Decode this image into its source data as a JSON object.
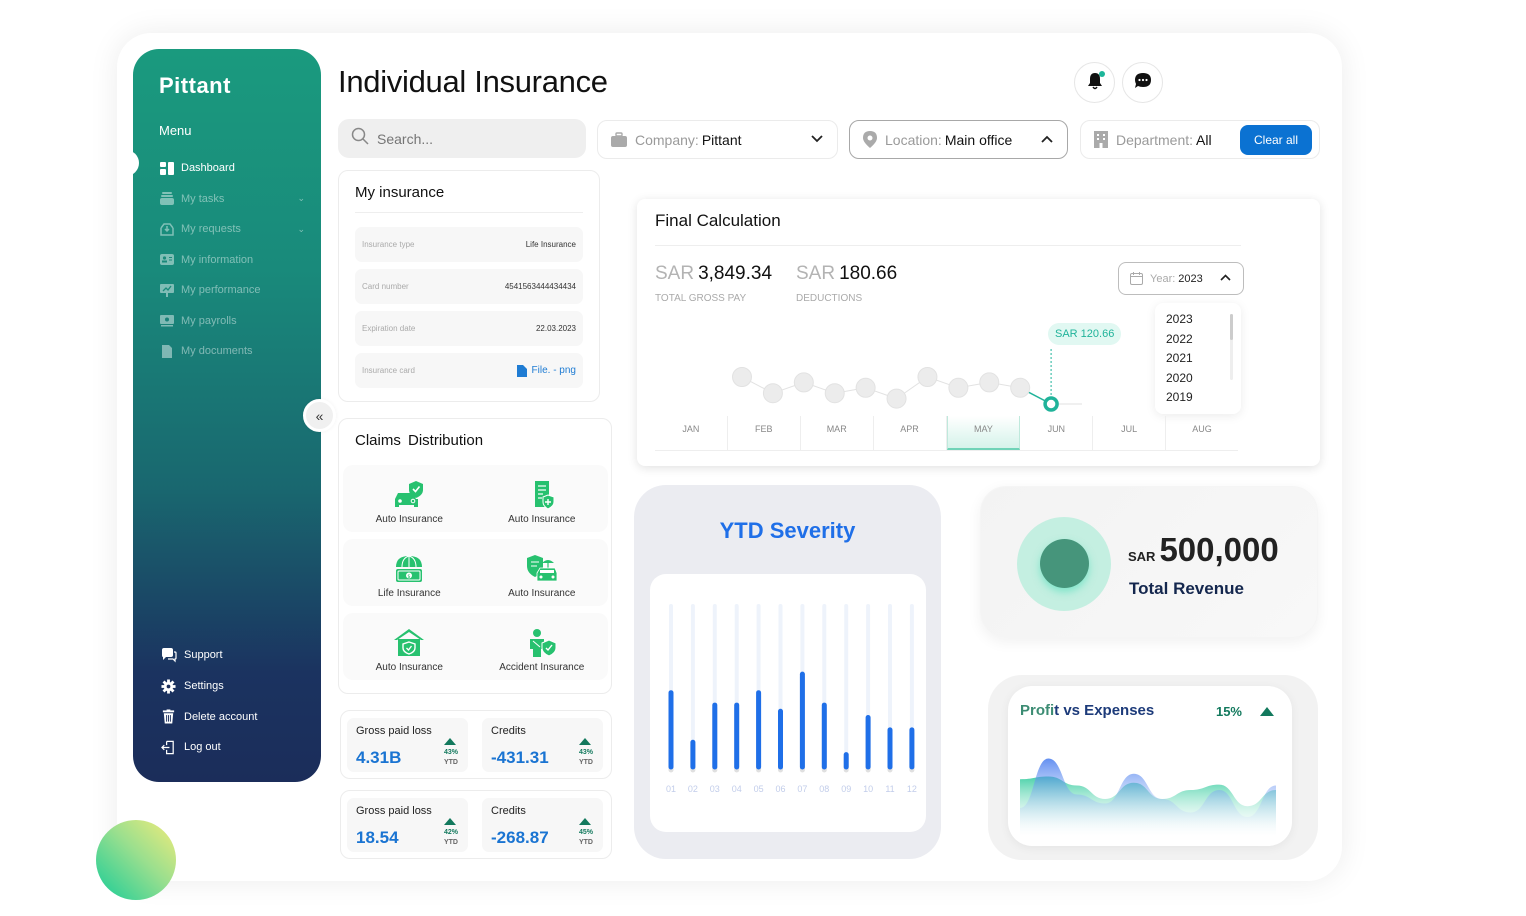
{
  "app": {
    "brand": "Pittant",
    "page_title": "Individual Insurance"
  },
  "sidebar": {
    "menu_title": "Menu",
    "items": [
      {
        "label": "Dashboard",
        "icon": "dashboard-icon",
        "active": true
      },
      {
        "label": "My tasks",
        "icon": "tasks-icon",
        "has_submenu": true
      },
      {
        "label": "My requests",
        "icon": "inbox-icon",
        "has_submenu": true
      },
      {
        "label": "My information",
        "icon": "id-card-icon"
      },
      {
        "label": "My performance",
        "icon": "performance-icon"
      },
      {
        "label": "My payrolls",
        "icon": "payroll-icon"
      },
      {
        "label": "My documents",
        "icon": "document-icon"
      }
    ],
    "bottom_items": [
      {
        "label": "Support",
        "icon": "chat-bubbles-icon"
      },
      {
        "label": "Settings",
        "icon": "gear-icon"
      },
      {
        "label": "Delete account",
        "icon": "trash-icon"
      },
      {
        "label": "Log out",
        "icon": "logout-icon"
      }
    ],
    "collapse_glyph": "«"
  },
  "header": {
    "search_placeholder": "Search...",
    "filters": {
      "company": {
        "label": "Company:",
        "value": "Pittant",
        "arrow": "⌄"
      },
      "location": {
        "label": "Location:",
        "value": "Main office",
        "arrow": "⌃"
      },
      "department": {
        "label": "Department:",
        "value": "All"
      }
    },
    "clear_all": "Clear all"
  },
  "my_insurance": {
    "title": "My insurance",
    "rows": [
      {
        "label": "Insurance type",
        "value": "Life Insurance"
      },
      {
        "label": "Card number",
        "value": "4541563444434434"
      },
      {
        "label": "Expiration date",
        "value": "22.03.2023"
      },
      {
        "label": "Insurance card",
        "value": "File. - png"
      }
    ]
  },
  "claims": {
    "title": "Claims  Distribution",
    "items": [
      {
        "label": "Auto Insurance",
        "icon": "car-shield-icon"
      },
      {
        "label": "Auto Insurance",
        "icon": "document-shield-icon"
      },
      {
        "label": "Life Insurance",
        "icon": "umbrella-money-icon"
      },
      {
        "label": "Auto Insurance",
        "icon": "car-umbrella-icon"
      },
      {
        "label": "Auto Insurance",
        "icon": "house-shield-icon"
      },
      {
        "label": "Accident Insurance",
        "icon": "person-shield-icon"
      }
    ]
  },
  "stats": [
    [
      {
        "title": "Gross paid loss",
        "value": "4.31B",
        "pct": "43%",
        "period": "YTD"
      },
      {
        "title": "Credits",
        "value": "-431.31",
        "pct": "43%",
        "period": "YTD"
      }
    ],
    [
      {
        "title": "Gross paid loss",
        "value": "18.54",
        "pct": "42%",
        "period": "YTD"
      },
      {
        "title": "Credits",
        "value": "-268.87",
        "pct": "45%",
        "period": "YTD"
      }
    ]
  ],
  "final_calc": {
    "title": "Final Calculation",
    "currency": "SAR",
    "gross_pay": "3,849.34",
    "gross_pay_caption": "TOTAL GROSS PAY",
    "deductions": "180.66",
    "deductions_caption": "DEDUCTIONS",
    "year_label": "Year:",
    "year_value": "2023",
    "year_options": [
      "2023",
      "2022",
      "2021",
      "2020",
      "2019"
    ],
    "tooltip": "SAR 120.66",
    "months": [
      "JAN",
      "FEB",
      "MAR",
      "APR",
      "MAY",
      "JUN",
      "JUL",
      "AUG"
    ],
    "active_month": "MAY",
    "accent": "#20b39a"
  },
  "chart_data": [
    {
      "type": "line",
      "title": "Final Calculation",
      "x": [
        1,
        2,
        3,
        4,
        5,
        6,
        7,
        8,
        9,
        10,
        11,
        12
      ],
      "values": [
        6,
        3,
        5,
        3,
        4,
        2,
        6,
        4,
        5,
        4,
        1,
        1
      ],
      "highlight_point_index": 10,
      "highlight_label": "SAR 120.66",
      "xticks": [
        "JAN",
        "FEB",
        "MAR",
        "APR",
        "MAY",
        "JUN",
        "JUL",
        "AUG"
      ],
      "grid": false
    },
    {
      "type": "bar",
      "title": "YTD Severity",
      "categories": [
        "01",
        "02",
        "03",
        "04",
        "05",
        "06",
        "07",
        "08",
        "09",
        "10",
        "11",
        "12"
      ],
      "values": [
        60,
        20,
        50,
        50,
        60,
        45,
        75,
        50,
        10,
        40,
        30,
        30
      ],
      "ylim": [
        0,
        130
      ],
      "color": "#1f6fe8",
      "grid": false
    },
    {
      "type": "area",
      "title": "Profit vs Expenses",
      "annotation": "15%",
      "series": [
        {
          "name": "Profit",
          "color": "#1fc694",
          "values": [
            52,
            55,
            45,
            30,
            48,
            30,
            40,
            46,
            22,
            40
          ]
        },
        {
          "name": "Expenses",
          "color": "#2563eb",
          "values": [
            20,
            75,
            35,
            25,
            58,
            30,
            15,
            40,
            10,
            45
          ]
        }
      ],
      "ylim": [
        0,
        100
      ]
    }
  ],
  "ytd": {
    "title": "YTD Severity"
  },
  "revenue": {
    "currency": "SAR",
    "amount": "500,000",
    "label": "Total Revenue"
  },
  "profit": {
    "title_a": "Profi",
    "title_b": "t vs Expenses",
    "pct": "15%"
  }
}
